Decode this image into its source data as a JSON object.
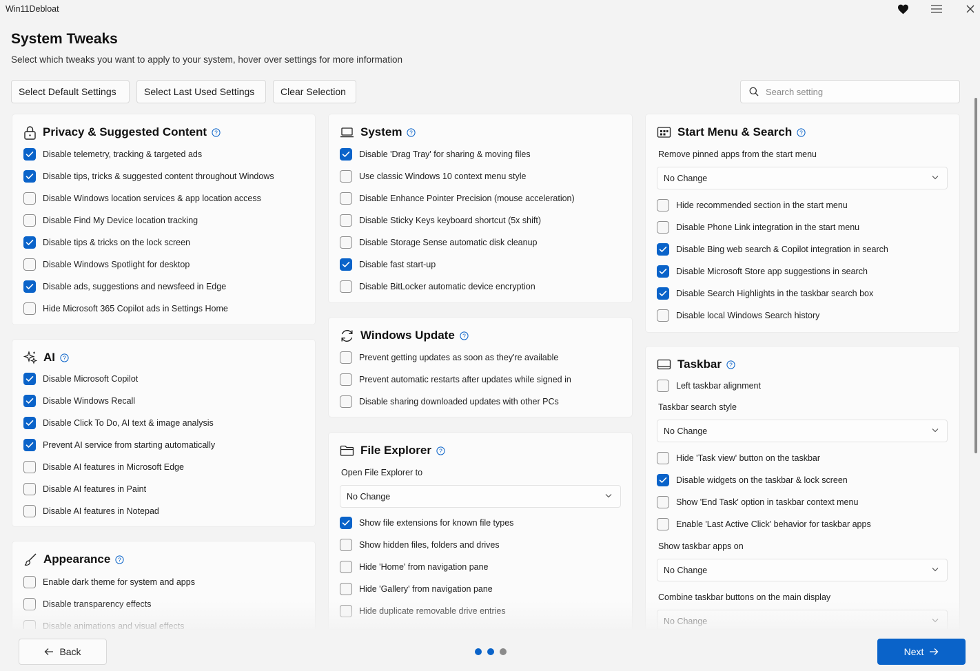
{
  "app": {
    "title": "Win11Debloat"
  },
  "page": {
    "title": "System Tweaks",
    "subtitle": "Select which tweaks you want to apply to your system, hover over settings for more information"
  },
  "toolbar": {
    "select_default": "Select Default Settings",
    "select_last": "Select Last Used Settings",
    "clear": "Clear Selection",
    "search_placeholder": "Search setting"
  },
  "colors": {
    "accent": "#0a63c9",
    "background": "#f3f3f3",
    "card": "#fbfbfb"
  },
  "sections": {
    "privacy": {
      "title": "Privacy & Suggested Content",
      "icon": "lock-icon",
      "items": [
        {
          "label": "Disable telemetry, tracking & targeted ads",
          "checked": true
        },
        {
          "label": "Disable tips, tricks & suggested content throughout Windows",
          "checked": true
        },
        {
          "label": "Disable Windows location services & app location access",
          "checked": false
        },
        {
          "label": "Disable Find My Device location tracking",
          "checked": false
        },
        {
          "label": "Disable tips & tricks on the lock screen",
          "checked": true
        },
        {
          "label": "Disable Windows Spotlight for desktop",
          "checked": false
        },
        {
          "label": "Disable ads, suggestions and newsfeed in Edge",
          "checked": true
        },
        {
          "label": "Hide Microsoft 365 Copilot ads in Settings Home",
          "checked": false
        }
      ]
    },
    "ai": {
      "title": "AI",
      "icon": "sparkle-icon",
      "items": [
        {
          "label": "Disable Microsoft Copilot",
          "checked": true
        },
        {
          "label": "Disable Windows Recall",
          "checked": true
        },
        {
          "label": "Disable Click To Do, AI text & image analysis",
          "checked": true
        },
        {
          "label": "Prevent AI service from starting automatically",
          "checked": true
        },
        {
          "label": "Disable AI features in Microsoft Edge",
          "checked": false
        },
        {
          "label": "Disable AI features in Paint",
          "checked": false
        },
        {
          "label": "Disable AI features in Notepad",
          "checked": false
        }
      ]
    },
    "appearance": {
      "title": "Appearance",
      "icon": "brush-icon",
      "items": [
        {
          "label": "Enable dark theme for system and apps",
          "checked": false
        },
        {
          "label": "Disable transparency effects",
          "checked": false
        },
        {
          "label": "Disable animations and visual effects",
          "checked": false
        }
      ]
    },
    "system": {
      "title": "System",
      "icon": "laptop-icon",
      "items": [
        {
          "label": "Disable 'Drag Tray' for sharing & moving files",
          "checked": true
        },
        {
          "label": "Use classic Windows 10 context menu style",
          "checked": false
        },
        {
          "label": "Disable Enhance Pointer Precision (mouse acceleration)",
          "checked": false
        },
        {
          "label": "Disable Sticky Keys keyboard shortcut (5x shift)",
          "checked": false
        },
        {
          "label": "Disable Storage Sense automatic disk cleanup",
          "checked": false
        },
        {
          "label": "Disable fast start-up",
          "checked": true
        },
        {
          "label": "Disable BitLocker automatic device encryption",
          "checked": false
        }
      ]
    },
    "update": {
      "title": "Windows Update",
      "icon": "refresh-icon",
      "items": [
        {
          "label": "Prevent getting updates as soon as they're available",
          "checked": false
        },
        {
          "label": "Prevent automatic restarts after updates while signed in",
          "checked": false
        },
        {
          "label": "Disable sharing downloaded updates with other PCs",
          "checked": false
        }
      ]
    },
    "explorer": {
      "title": "File Explorer",
      "icon": "folder-icon",
      "open_label": "Open File Explorer to",
      "open_value": "No Change",
      "items": [
        {
          "label": "Show file extensions for known file types",
          "checked": true
        },
        {
          "label": "Show hidden files, folders and drives",
          "checked": false
        },
        {
          "label": "Hide 'Home' from navigation pane",
          "checked": false
        },
        {
          "label": "Hide 'Gallery' from navigation pane",
          "checked": false
        },
        {
          "label": "Hide duplicate removable drive entries",
          "checked": false
        }
      ]
    },
    "start": {
      "title": "Start Menu & Search",
      "icon": "start-menu-icon",
      "pinned_label": "Remove pinned apps from the start menu",
      "pinned_value": "No Change",
      "items": [
        {
          "label": "Hide recommended section in the start menu",
          "checked": false
        },
        {
          "label": "Disable Phone Link integration in the start menu",
          "checked": false
        },
        {
          "label": "Disable Bing web search & Copilot integration in search",
          "checked": true
        },
        {
          "label": "Disable Microsoft Store app suggestions in search",
          "checked": true
        },
        {
          "label": "Disable Search Highlights in the taskbar search box",
          "checked": true
        },
        {
          "label": "Disable local Windows Search history",
          "checked": false
        }
      ]
    },
    "taskbar": {
      "title": "Taskbar",
      "icon": "taskbar-icon",
      "align": {
        "label": "Left taskbar alignment",
        "checked": false
      },
      "search_style_label": "Taskbar search style",
      "search_style_value": "No Change",
      "items": [
        {
          "label": "Hide 'Task view' button on the taskbar",
          "checked": false
        },
        {
          "label": "Disable widgets on the taskbar & lock screen",
          "checked": true
        },
        {
          "label": "Show 'End Task' option in taskbar context menu",
          "checked": false
        },
        {
          "label": "Enable 'Last Active Click' behavior for taskbar apps",
          "checked": false
        }
      ],
      "apps_on_label": "Show taskbar apps on",
      "apps_on_value": "No Change",
      "combine_label": "Combine taskbar buttons on the main display",
      "combine_value": "No Change"
    }
  },
  "footer": {
    "back": "Back",
    "next": "Next",
    "step": 1,
    "steps_total": 3
  }
}
